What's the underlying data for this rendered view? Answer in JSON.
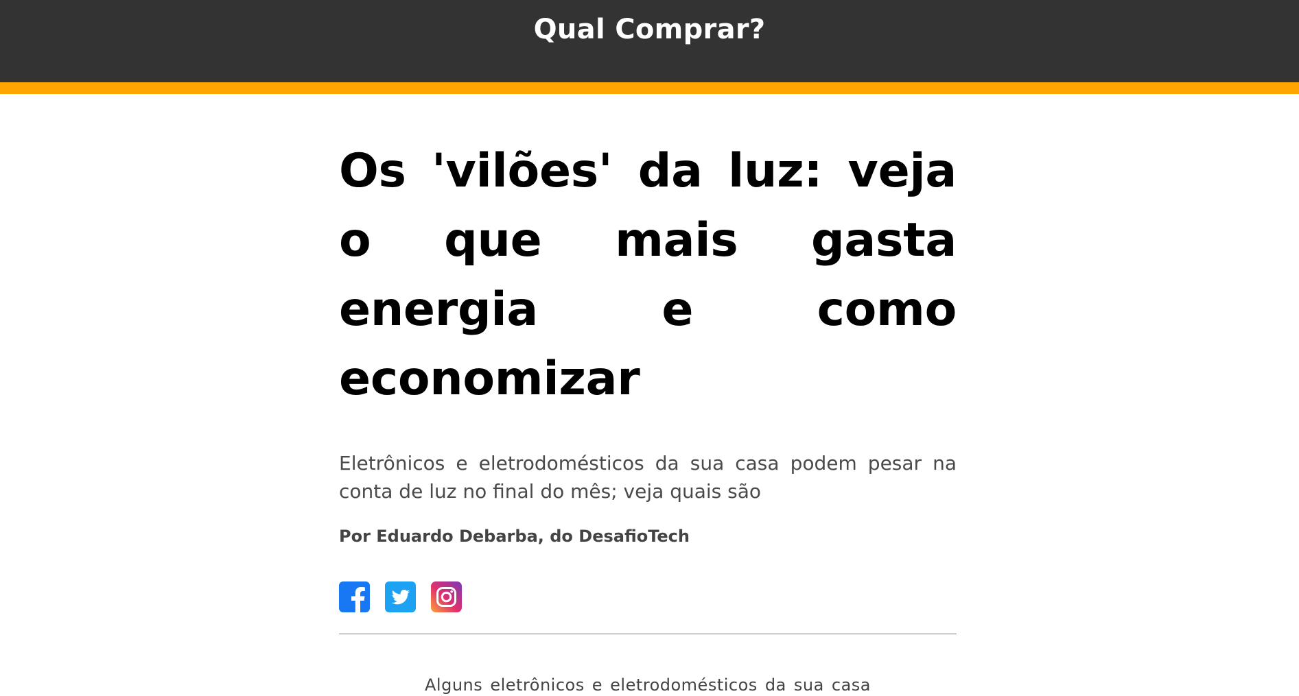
{
  "site": {
    "title": "Qual Comprar?",
    "header_bg": "#333333",
    "accent": "#ffa500"
  },
  "article": {
    "headline": "Os 'vilões' da luz: veja o que mais gasta energia e como economizar",
    "subtitle": "Eletrônicos e eletrodomésticos da sua casa podem pesar na conta de luz no final do mês; veja quais são",
    "byline": "Por Eduardo Debarba, do DesafioTech",
    "lead": "Alguns eletrônicos e eletrodomésticos da sua casa"
  },
  "social": [
    {
      "icon": "facebook-icon",
      "color": "#1877f2"
    },
    {
      "icon": "twitter-icon",
      "color": "#1da1f2"
    },
    {
      "icon": "instagram-icon",
      "color": "#c13584"
    }
  ]
}
